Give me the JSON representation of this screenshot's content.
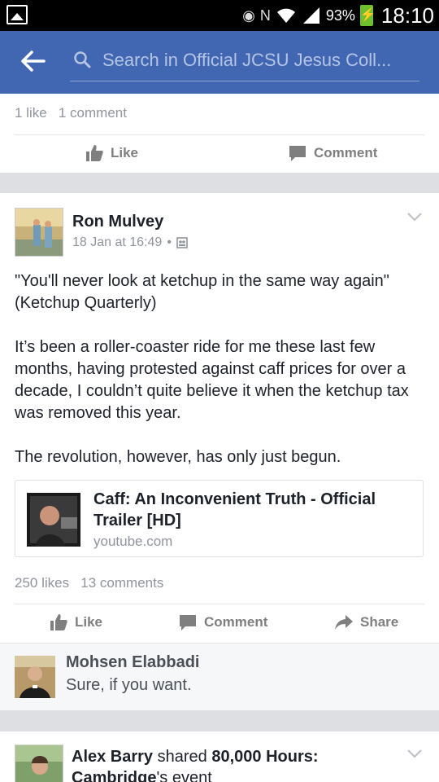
{
  "status_bar": {
    "battery_percent": "93%",
    "time": "18:10",
    "icons": [
      "gallery-icon",
      "eye-icon",
      "nfc-icon",
      "wifi-icon",
      "signal-icon",
      "battery-charging-icon"
    ]
  },
  "header": {
    "search_placeholder": "Search in Official JCSU Jesus Coll..."
  },
  "previous_post": {
    "likes": "1 like",
    "comments": "1 comment",
    "like_label": "Like",
    "comment_label": "Comment"
  },
  "post": {
    "author": "Ron Mulvey",
    "timestamp": "18 Jan at 16:49",
    "paragraph_1": "\"You'll never look at ketchup in the same way again\" (Ketchup Quarterly)",
    "paragraph_2": "It’s been a roller-coaster ride for me these last few months, having protested against caff prices for over a decade, I couldn’t quite believe it when the ketchup tax was removed this year.",
    "paragraph_3": "The revolution, however, has only just begun.",
    "link": {
      "title": "Caff: An Inconvenient Truth - Official Trailer [HD]",
      "domain": "youtube.com"
    },
    "likes": "250 likes",
    "comments": "13 comments",
    "like_label": "Like",
    "comment_label": "Comment",
    "share_label": "Share",
    "top_comment": {
      "author": "Mohsen Elabbadi",
      "text": "Sure, if you want."
    }
  },
  "next_post": {
    "author": "Alex Barry",
    "verb": "shared",
    "target": "80,000 Hours:",
    "line2_bold": "Cambridge",
    "line2_rest": "'s event"
  },
  "colors": {
    "header_blue": "#4267b2",
    "status_black": "#000000",
    "separator_gray": "#dddfe2",
    "action_gray": "#7f7f7f"
  }
}
